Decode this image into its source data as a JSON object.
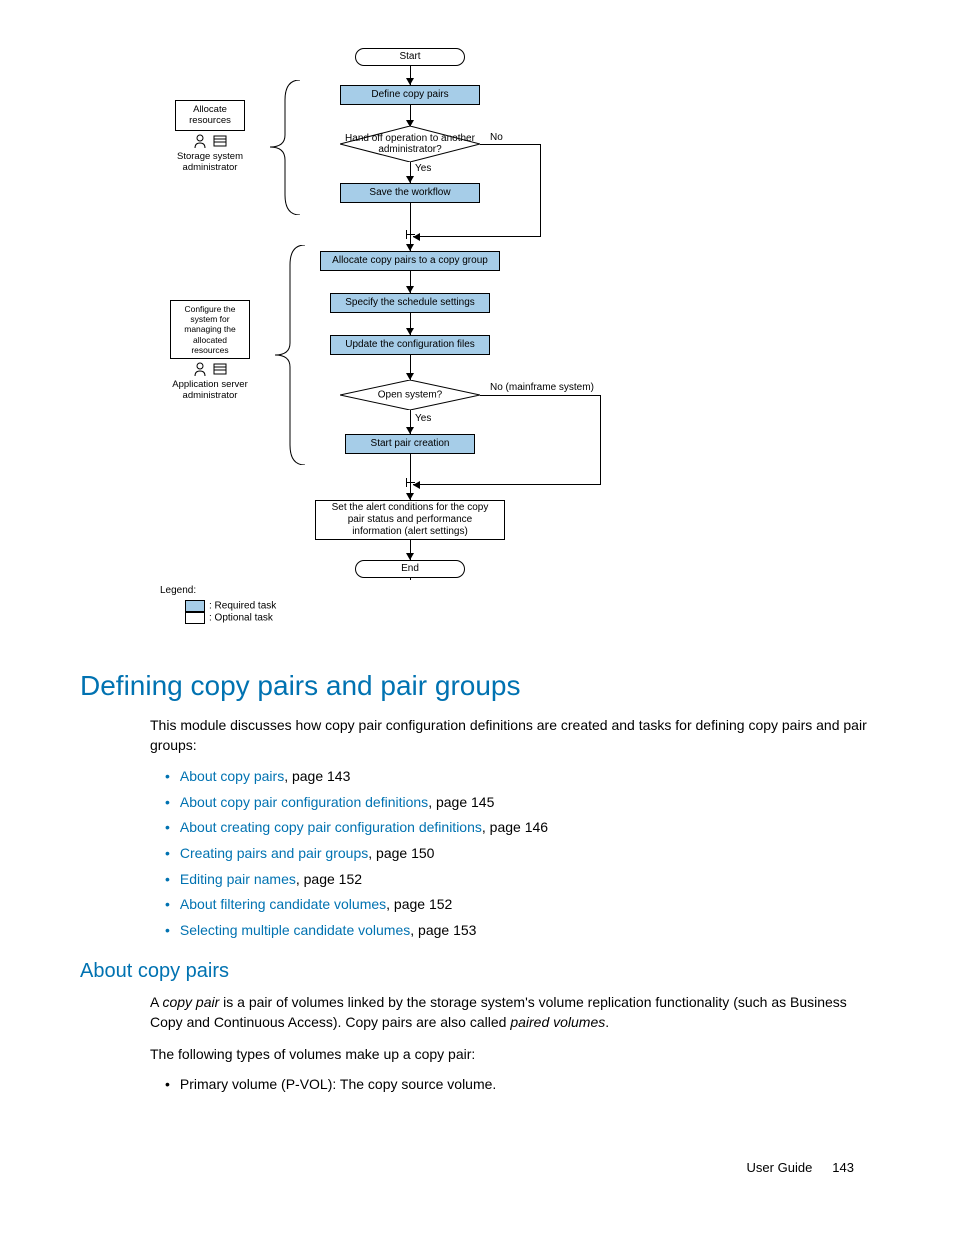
{
  "flowchart": {
    "start": "Start",
    "define_copy_pairs": "Define copy pairs",
    "handoff_decision": "Hand off operation to another administrator?",
    "no": "No",
    "yes": "Yes",
    "save_workflow": "Save the workflow",
    "allocate_to_group": "Allocate copy pairs to a copy group",
    "schedule": "Specify the schedule settings",
    "update_config": "Update the configuration files",
    "open_system_decision": "Open system?",
    "no_mainframe": "No (mainframe system)",
    "start_pair_creation": "Start pair creation",
    "alert_settings": "Set the alert conditions for the copy pair status and performance information (alert settings)",
    "end": "End",
    "side1_allocate": "Allocate resources",
    "side1_role": "Storage system administrator",
    "side2_configure": "Configure the system for managing the allocated resources",
    "side2_role": "Application server administrator",
    "legend_label": "Legend:",
    "legend_required": ": Required task",
    "legend_optional": ": Optional task"
  },
  "h1": "Defining copy pairs and pair groups",
  "intro": "This module discusses how copy pair configuration definitions are created and tasks for defining copy pairs and pair groups:",
  "links": [
    {
      "text": "About copy pairs",
      "page": ", page 143"
    },
    {
      "text": "About copy pair configuration definitions",
      "page": ", page 145"
    },
    {
      "text": "About creating copy pair configuration definitions",
      "page": ", page 146"
    },
    {
      "text": "Creating pairs and pair groups",
      "page": ", page 150"
    },
    {
      "text": "Editing pair names",
      "page": ", page 152"
    },
    {
      "text": "About filtering candidate volumes",
      "page": ", page 152"
    },
    {
      "text": "Selecting multiple candidate volumes",
      "page": ", page 153"
    }
  ],
  "h2": "About copy pairs",
  "para1_a": "A ",
  "para1_em": "copy pair",
  "para1_b": " is a pair of volumes linked by the storage system's volume replication functionality (such as Business Copy and Continuous Access). Copy pairs are also called ",
  "para1_em2": "paired volumes",
  "para1_c": ".",
  "para2": "The following types of volumes make up a copy pair:",
  "bullet_pvol": "Primary volume (P-VOL): The copy source volume.",
  "footer_label": "User Guide",
  "footer_page": "143"
}
